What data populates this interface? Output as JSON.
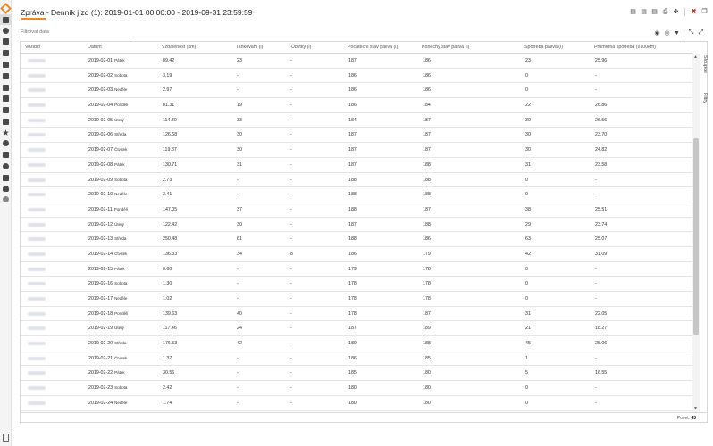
{
  "header": {
    "title": "Zpráva - Denník jízd (1): 2019-01-01 00:00:00 - 2019-09-31 23:59:59",
    "icons": [
      "pdf-icon",
      "doc-icon",
      "xls-icon",
      "print-icon",
      "expand-icon",
      "close-icon",
      "restore-icon"
    ]
  },
  "filter": {
    "placeholder": "Filtrovat data"
  },
  "columns": [
    "Vozidlo",
    "Datum",
    "Vzdálenost (km)",
    "Tankování (l)",
    "Úbytky (l)",
    "Počáteční stav paliva (l)",
    "Konečný stav paliva (l)",
    "Spotřeba paliva (l)",
    "Průměrná spotřeba (l/100km)"
  ],
  "rows": [
    {
      "date": "2019-02-01",
      "day": "Pátek",
      "dist": "89.42",
      "tank": "23",
      "loss": "-",
      "start": "187",
      "end": "186",
      "cons": "23",
      "avg": "25.96"
    },
    {
      "date": "2019-02-02",
      "day": "Sobota",
      "dist": "3.19",
      "tank": "-",
      "loss": "-",
      "start": "186",
      "end": "186",
      "cons": "0",
      "avg": "-"
    },
    {
      "date": "2019-02-03",
      "day": "Neděle",
      "dist": "2.97",
      "tank": "-",
      "loss": "-",
      "start": "186",
      "end": "186",
      "cons": "0",
      "avg": "-"
    },
    {
      "date": "2019-02-04",
      "day": "Pondělí",
      "dist": "81.31",
      "tank": "19",
      "loss": "-",
      "start": "186",
      "end": "184",
      "cons": "22",
      "avg": "26.86"
    },
    {
      "date": "2019-02-05",
      "day": "Úterý",
      "dist": "114.30",
      "tank": "33",
      "loss": "-",
      "start": "184",
      "end": "187",
      "cons": "30",
      "avg": "26.56"
    },
    {
      "date": "2019-02-06",
      "day": "Středa",
      "dist": "126.68",
      "tank": "30",
      "loss": "-",
      "start": "187",
      "end": "187",
      "cons": "30",
      "avg": "23.70"
    },
    {
      "date": "2019-02-07",
      "day": "Čtvrtek",
      "dist": "119.87",
      "tank": "30",
      "loss": "-",
      "start": "187",
      "end": "187",
      "cons": "30",
      "avg": "24.82"
    },
    {
      "date": "2019-02-08",
      "day": "Pátek",
      "dist": "130.71",
      "tank": "31",
      "loss": "-",
      "start": "187",
      "end": "188",
      "cons": "31",
      "avg": "23.58"
    },
    {
      "date": "2019-02-09",
      "day": "Sobota",
      "dist": "2.73",
      "tank": "-",
      "loss": "-",
      "start": "188",
      "end": "188",
      "cons": "0",
      "avg": "-"
    },
    {
      "date": "2019-02-10",
      "day": "Neděle",
      "dist": "3.41",
      "tank": "-",
      "loss": "-",
      "start": "188",
      "end": "188",
      "cons": "0",
      "avg": "-"
    },
    {
      "date": "2019-02-11",
      "day": "Pondělí",
      "dist": "147.05",
      "tank": "37",
      "loss": "-",
      "start": "188",
      "end": "187",
      "cons": "38",
      "avg": "25.51"
    },
    {
      "date": "2019-02-12",
      "day": "Úterý",
      "dist": "122.42",
      "tank": "30",
      "loss": "-",
      "start": "187",
      "end": "188",
      "cons": "29",
      "avg": "23.74"
    },
    {
      "date": "2019-02-13",
      "day": "Středa",
      "dist": "250.48",
      "tank": "61",
      "loss": "-",
      "start": "188",
      "end": "186",
      "cons": "63",
      "avg": "25.07"
    },
    {
      "date": "2019-02-14",
      "day": "Čtvrtek",
      "dist": "136.33",
      "tank": "34",
      "loss": "8",
      "start": "186",
      "end": "179",
      "cons": "42",
      "avg": "31.09"
    },
    {
      "date": "2019-02-15",
      "day": "Pátek",
      "dist": "0.60",
      "tank": "-",
      "loss": "-",
      "start": "179",
      "end": "178",
      "cons": "0",
      "avg": "-"
    },
    {
      "date": "2019-02-16",
      "day": "Sobota",
      "dist": "1.30",
      "tank": "-",
      "loss": "-",
      "start": "178",
      "end": "178",
      "cons": "0",
      "avg": "-"
    },
    {
      "date": "2019-02-17",
      "day": "Neděle",
      "dist": "1.02",
      "tank": "-",
      "loss": "-",
      "start": "178",
      "end": "178",
      "cons": "0",
      "avg": "-"
    },
    {
      "date": "2019-02-18",
      "day": "Pondělí",
      "dist": "139.63",
      "tank": "40",
      "loss": "-",
      "start": "178",
      "end": "187",
      "cons": "31",
      "avg": "22.05"
    },
    {
      "date": "2019-02-19",
      "day": "Úterý",
      "dist": "117.46",
      "tank": "24",
      "loss": "-",
      "start": "187",
      "end": "189",
      "cons": "21",
      "avg": "18.27"
    },
    {
      "date": "2019-02-20",
      "day": "Středa",
      "dist": "176.53",
      "tank": "42",
      "loss": "-",
      "start": "189",
      "end": "188",
      "cons": "45",
      "avg": "25.06"
    },
    {
      "date": "2019-02-21",
      "day": "Čtvrtek",
      "dist": "1.37",
      "tank": "-",
      "loss": "-",
      "start": "186",
      "end": "185",
      "cons": "1",
      "avg": "-"
    },
    {
      "date": "2019-02-22",
      "day": "Pátek",
      "dist": "30.56",
      "tank": "-",
      "loss": "-",
      "start": "185",
      "end": "180",
      "cons": "5",
      "avg": "16.55"
    },
    {
      "date": "2019-02-23",
      "day": "Sobota",
      "dist": "2.42",
      "tank": "-",
      "loss": "-",
      "start": "180",
      "end": "180",
      "cons": "0",
      "avg": "-"
    },
    {
      "date": "2019-02-24",
      "day": "Neděle",
      "dist": "1.74",
      "tank": "-",
      "loss": "-",
      "start": "180",
      "end": "180",
      "cons": "0",
      "avg": "-"
    }
  ],
  "sidetabs": {
    "columns": "Sloupce",
    "filters": "Filtry"
  },
  "footer": {
    "count_label": "Počet:",
    "count_value": "43"
  },
  "colors": {
    "accent": "#f08a24",
    "close": "#d32b2b"
  }
}
